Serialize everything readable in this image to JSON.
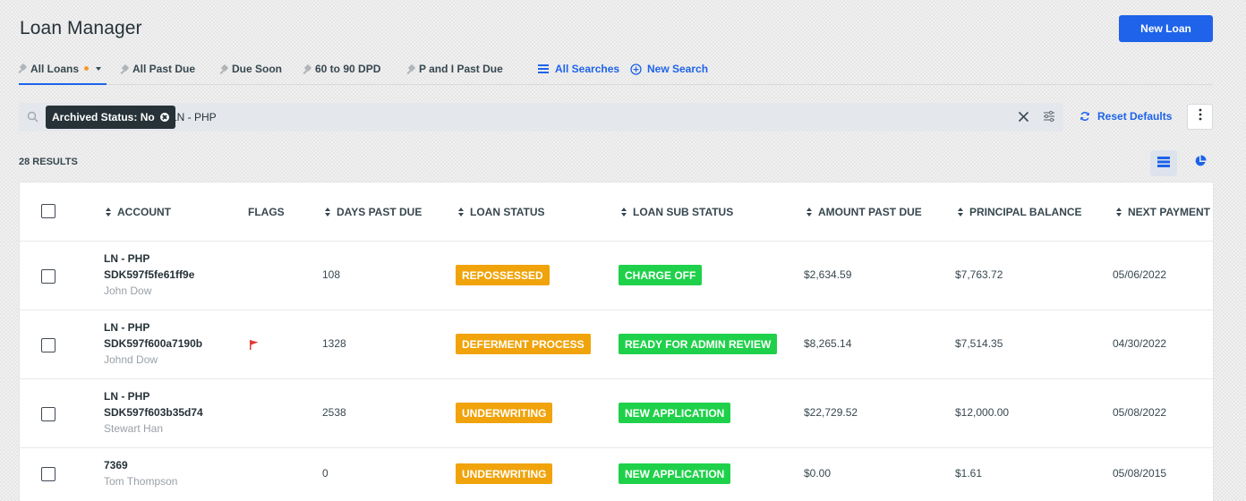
{
  "header": {
    "title": "Loan Manager",
    "new_loan_label": "New Loan"
  },
  "tabs": [
    {
      "label": "All Loans",
      "active": true,
      "modified": true
    },
    {
      "label": "All Past Due"
    },
    {
      "label": "Due Soon"
    },
    {
      "label": "60 to 90 DPD"
    },
    {
      "label": "P and I Past Due"
    }
  ],
  "tab_links": {
    "all_searches": "All Searches",
    "new_search": "New Search"
  },
  "search": {
    "chip_label": "Archived Status: No",
    "query": "LN - PHP",
    "reset_label": "Reset Defaults"
  },
  "results_label": "28 RESULTS",
  "table": {
    "columns": [
      "ACCOUNT",
      "FLAGS",
      "DAYS PAST DUE",
      "LOAN STATUS",
      "LOAN SUB STATUS",
      "AMOUNT PAST DUE",
      "PRINCIPAL BALANCE",
      "NEXT PAYMENT D"
    ],
    "rows": [
      {
        "account_line1": "LN - PHP",
        "account_line2": "SDK597f5fe61ff9e",
        "name": "John Dow",
        "flag": false,
        "days_past_due": "108",
        "loan_status": "REPOSSESSED",
        "loan_sub_status": "CHARGE OFF",
        "amount_past_due": "$2,634.59",
        "principal_balance": "$7,763.72",
        "next_payment": "05/06/2022"
      },
      {
        "account_line1": "LN - PHP",
        "account_line2": "SDK597f600a7190b",
        "name": "Johnd Dow",
        "flag": true,
        "days_past_due": "1328",
        "loan_status": "DEFERMENT PROCESS",
        "loan_sub_status": "READY FOR ADMIN REVIEW",
        "amount_past_due": "$8,265.14",
        "principal_balance": "$7,514.35",
        "next_payment": "04/30/2022"
      },
      {
        "account_line1": "LN - PHP",
        "account_line2": "SDK597f603b35d74",
        "name": "Stewart Han",
        "flag": false,
        "days_past_due": "2538",
        "loan_status": "UNDERWRITING",
        "loan_sub_status": "NEW APPLICATION",
        "amount_past_due": "$22,729.52",
        "principal_balance": "$12,000.00",
        "next_payment": "05/08/2022"
      },
      {
        "account_line1": "7369",
        "account_line2": "",
        "name": "Tom Thompson",
        "flag": false,
        "days_past_due": "0",
        "loan_status": "UNDERWRITING",
        "loan_sub_status": "NEW APPLICATION",
        "amount_past_due": "$0.00",
        "principal_balance": "$1.61",
        "next_payment": "05/08/2015"
      }
    ]
  },
  "colors": {
    "accent": "#1e63e9",
    "status_orange": "#f0a30a",
    "status_green": "#1fd14a",
    "flag_red": "#e53935"
  },
  "icons": {
    "pin": "pin-icon",
    "list": "list-icon",
    "add_circle": "add-circle-icon",
    "search": "search-icon",
    "close": "close-icon",
    "filter": "filter-settings-icon",
    "refresh": "refresh-icon",
    "kebab": "kebab-menu-icon",
    "table_view": "table-view-icon",
    "pie_view": "pie-chart-icon",
    "flag": "flag-icon"
  }
}
